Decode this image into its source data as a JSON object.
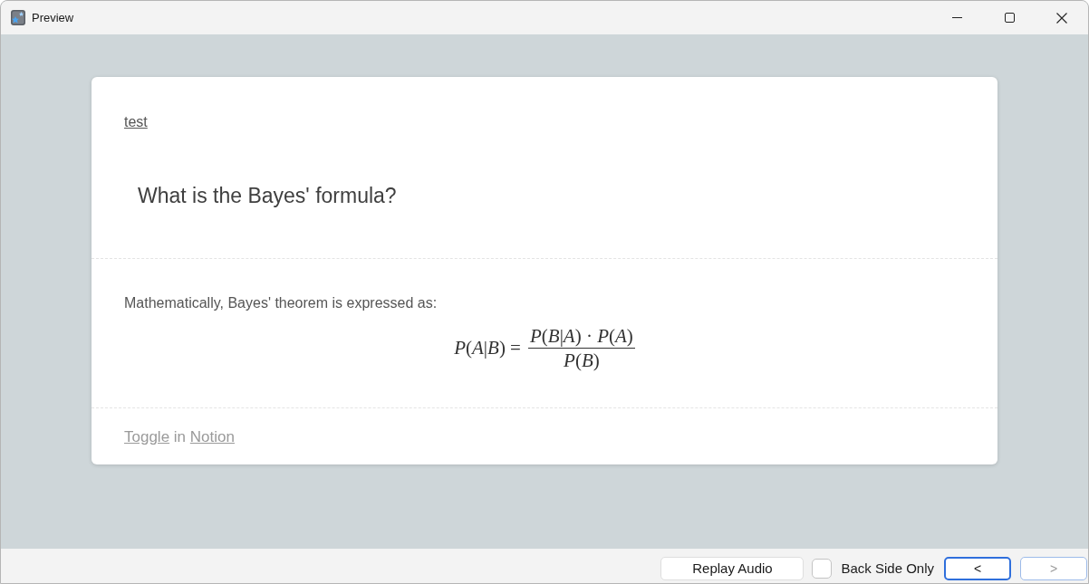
{
  "window": {
    "title": "Preview"
  },
  "card": {
    "deck_link": "test",
    "question": "What is the Bayes' formula?",
    "answer": {
      "text": "Mathematically, Bayes' theorem is expressed as:",
      "formula": {
        "lhs": "*P*(*A*|*B*) =",
        "numerator": "*P*(*B*|*A*) · *P*(*A*)",
        "denominator": "*P*(*B*)"
      }
    },
    "footer": [
      {
        "kind": "link",
        "text": "Toggle"
      },
      {
        "kind": "text",
        "text": "in"
      },
      {
        "kind": "link",
        "text": "Notion"
      }
    ]
  },
  "bottom_bar": {
    "replay_button": "Replay Audio",
    "back_side_only": {
      "label": "Back Side Only",
      "checked": false
    },
    "prev_button": {
      "label": "<",
      "focused": true,
      "disabled": false
    },
    "next_button": {
      "label": ">",
      "focused": false,
      "disabled": true
    }
  }
}
